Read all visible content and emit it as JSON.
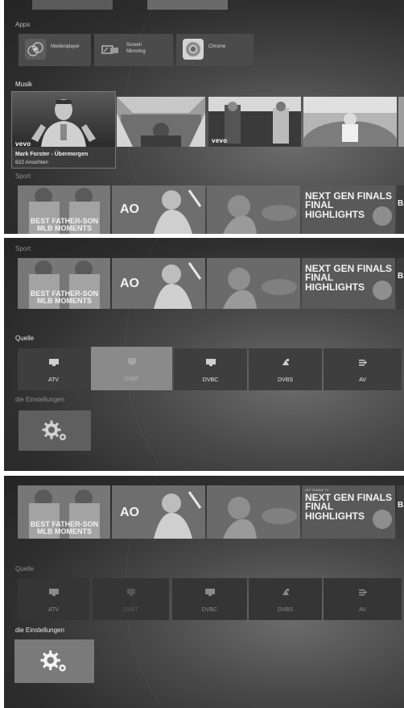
{
  "screen1": {
    "apps_label": "Apps",
    "apps": [
      {
        "label": "Medienplayer",
        "icon": "media-player-icon"
      },
      {
        "label": "Screen\nMirroring",
        "icon": "screen-mirroring-icon"
      },
      {
        "label": "Chrome",
        "icon": "chrome-icon"
      }
    ],
    "music_label": "Musik",
    "featured_title": "Mark Forster - Übermorgen",
    "featured_views": "622 Ansichten",
    "vevo_label": "vevo",
    "sport_label": "Sport"
  },
  "sport_tiles": {
    "tile1_text": "BEST FATHER-SON\nMLB MOMENTS",
    "tile2_text": "AO",
    "tile4_caption": "ATP TENNIS TV",
    "tile4_text": "NEXT GEN FINALS\nFINAL\nHIGHLIGHTS",
    "tile5_text": "BA"
  },
  "screen2": {
    "sport_label": "Sport",
    "source_label": "Quelle",
    "sources": [
      "ATV",
      "DVBT",
      "DVBC",
      "DVBS",
      "AV"
    ],
    "settings_label": "die Einstellungen"
  },
  "screen3": {
    "source_label": "Quelle",
    "sources": [
      "ATV",
      "DVBT",
      "DVBC",
      "DVBS",
      "AV"
    ],
    "settings_label": "die Einstellungen"
  },
  "colors": {
    "background": "#2e2e2e",
    "selected_tile": "#8a8a8a",
    "tile": "#3e3e3e"
  }
}
